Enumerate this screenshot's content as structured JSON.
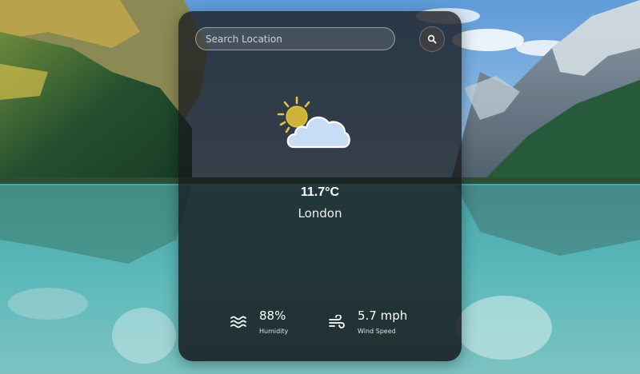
{
  "search": {
    "placeholder": "Search Location",
    "button_icon": "search-icon"
  },
  "weather": {
    "icon": "partly-cloudy-icon",
    "temperature": "11.7°C",
    "city": "London"
  },
  "stats": {
    "humidity": {
      "icon": "waves-icon",
      "value": "88%",
      "label": "Humidity"
    },
    "wind": {
      "icon": "wind-icon",
      "value": "5.7 mph",
      "label": "Wind Speed"
    }
  },
  "colors": {
    "sun": "#e4c53c",
    "cloud": "#c7dcf5",
    "card_bg": "#1c1e22"
  }
}
